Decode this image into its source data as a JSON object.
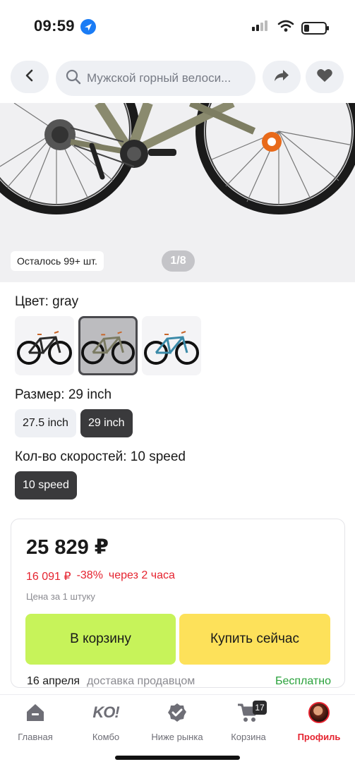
{
  "status_bar": {
    "time": "09:59"
  },
  "search": {
    "query": "Мужской горный велоси..."
  },
  "hero": {
    "stock_text": "Осталось 99+ шт.",
    "page_indicator": "1/8"
  },
  "options": {
    "color_label": "Цвет: gray",
    "color_icons": [
      "bike-black-icon",
      "bike-gray-icon",
      "bike-blue-icon"
    ],
    "size_label": "Размер: 29 inch",
    "sizes": [
      "27.5 inch",
      "29 inch"
    ],
    "speed_label": "Кол-во скоростей: 10 speed",
    "speeds": [
      "10 speed"
    ]
  },
  "price": {
    "main": "25 829 ₽",
    "promo_price": "16 091 ₽",
    "discount": "-38%",
    "promo_timer": "через 2 часа",
    "unit_note": "Цена за 1 штуку",
    "add_to_cart": "В корзину",
    "buy_now": "Купить сейчас"
  },
  "delivery": {
    "date": "16 апреля",
    "method": "доставка продавцом",
    "cost": "Бесплатно"
  },
  "tabs": [
    {
      "label": "Главная",
      "icon": "home-icon"
    },
    {
      "label": "Комбо",
      "icon": "ko-logo-icon"
    },
    {
      "label": "Ниже рынка",
      "icon": "badge-check-icon"
    },
    {
      "label": "Корзина",
      "icon": "cart-icon",
      "badge": "17"
    },
    {
      "label": "Профиль",
      "icon": "avatar"
    }
  ],
  "colors": {
    "accent_red": "#e5232f",
    "cart_green": "#c7f35a",
    "buy_yellow": "#fde15a",
    "free_green": "#2aa23c"
  },
  "battery_level": 0.25
}
